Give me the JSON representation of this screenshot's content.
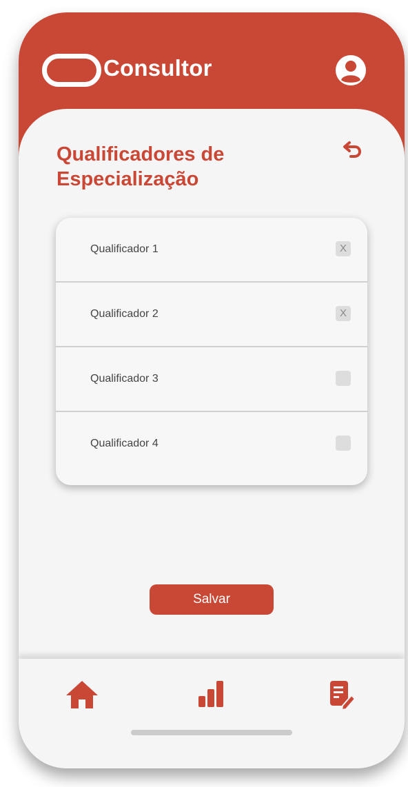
{
  "app": {
    "name": "Consultor"
  },
  "page": {
    "title": "Qualificadores de Especialização"
  },
  "qualifiers": [
    {
      "label": "Qualificador 1",
      "checked": true,
      "mark": "X"
    },
    {
      "label": "Qualificador 2",
      "checked": true,
      "mark": "X"
    },
    {
      "label": "Qualificador 3",
      "checked": false,
      "mark": ""
    },
    {
      "label": "Qualificador 4",
      "checked": false,
      "mark": ""
    }
  ],
  "actions": {
    "save_label": "Salvar"
  },
  "icons": {
    "logo": "rounded-rectangle-logo-icon",
    "profile": "user-circle-icon",
    "back": "undo-arrow-icon",
    "home": "home-icon",
    "stats": "bar-chart-icon",
    "notes": "edit-document-icon"
  },
  "colors": {
    "accent": "#c94735",
    "background": "#f5f5f5",
    "checkbox": "#dddddd"
  }
}
